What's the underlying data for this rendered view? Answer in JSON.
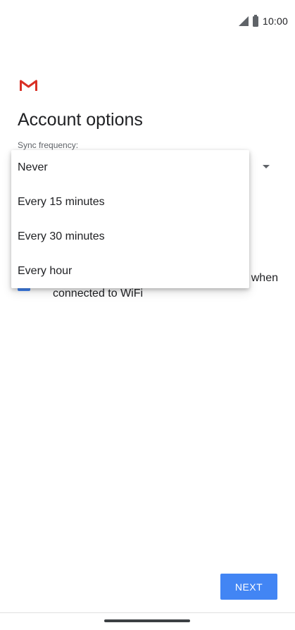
{
  "status_bar": {
    "time": "10:00",
    "icons": [
      "cell-signal-icon",
      "battery-icon"
    ]
  },
  "app": {
    "logo_icon": "gmail-icon",
    "colors": {
      "gmail_red": "#d93025",
      "accent_blue": "#4285f4"
    }
  },
  "page": {
    "title": "Account options"
  },
  "sync": {
    "label": "Sync frequency:",
    "options": [
      {
        "label": "Never"
      },
      {
        "label": "Every 15 minutes"
      },
      {
        "label": "Every 30 minutes"
      },
      {
        "label": "Every hour"
      }
    ]
  },
  "wifi_option": {
    "checked": true,
    "text_line1": "when",
    "text_line2": "connected to WiFi"
  },
  "actions": {
    "next_label": "NEXT"
  }
}
